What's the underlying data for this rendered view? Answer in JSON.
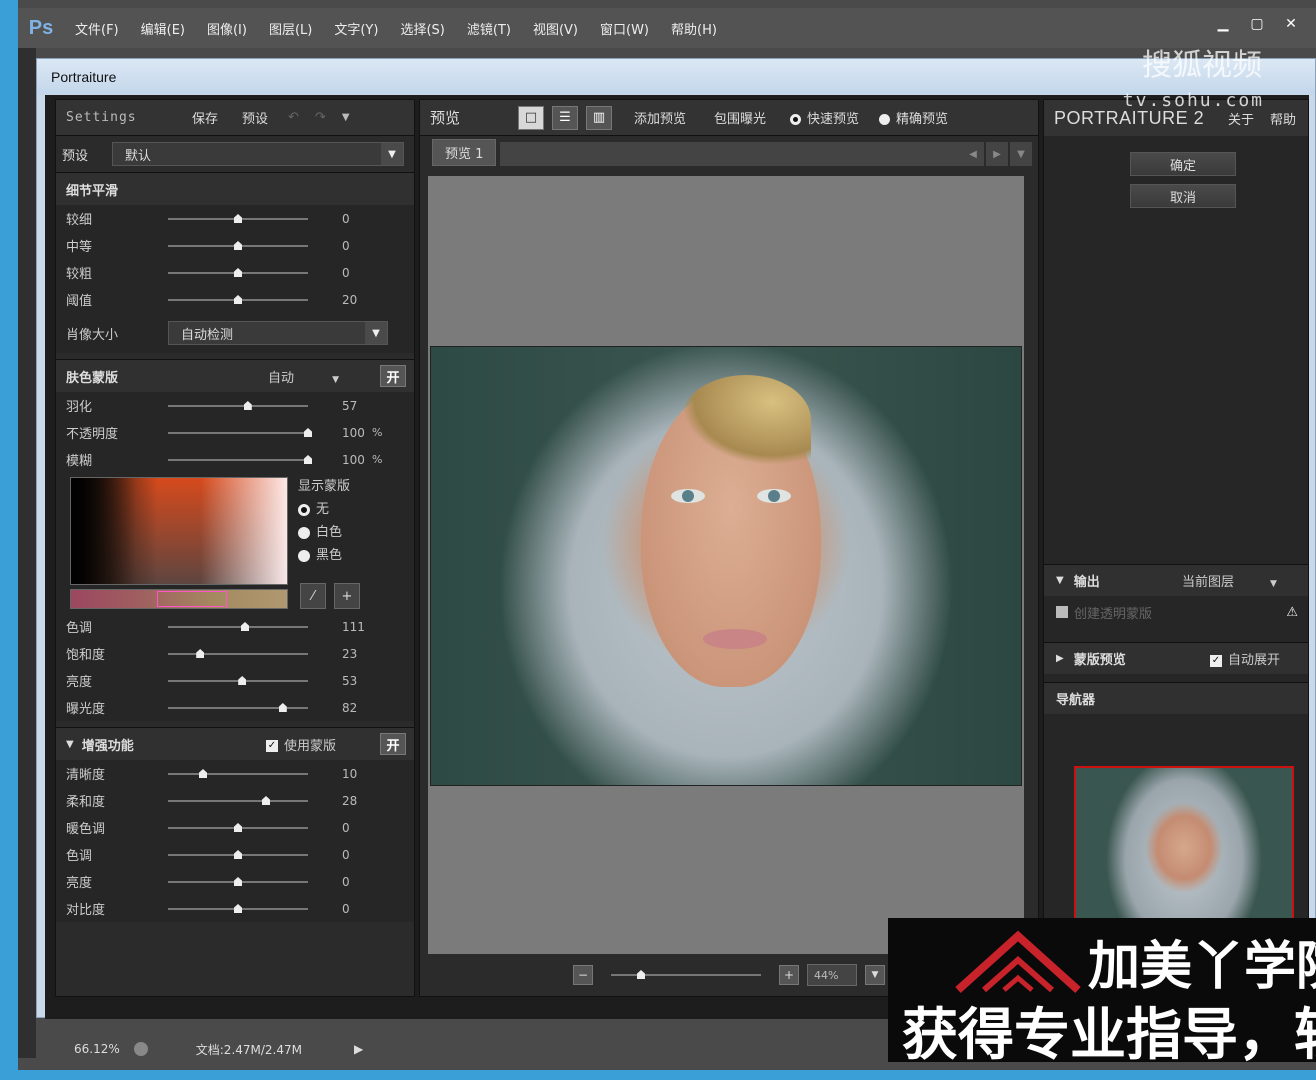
{
  "ps": {
    "logo": "Ps",
    "menu": [
      "文件(F)",
      "编辑(E)",
      "图像(I)",
      "图层(L)",
      "文字(Y)",
      "选择(S)",
      "滤镜(T)",
      "视图(V)",
      "窗口(W)",
      "帮助(H)"
    ]
  },
  "dialog": {
    "title": "Portraiture"
  },
  "settings": {
    "header_label": "Settings",
    "save": "保存",
    "preset": "预设",
    "preset_label": "预设",
    "preset_value": "默认"
  },
  "detail": {
    "title": "细节平滑",
    "sliders": [
      {
        "name": "较细",
        "value": "0",
        "pos": 0.5
      },
      {
        "name": "中等",
        "value": "0",
        "pos": 0.5
      },
      {
        "name": "较粗",
        "value": "0",
        "pos": 0.5
      },
      {
        "name": "阈值",
        "value": "20",
        "pos": 0.5
      }
    ],
    "size_label": "肖像大小",
    "size_value": "自动检测"
  },
  "skin": {
    "title": "肤色蒙版",
    "mode": "自动",
    "toggle": "开",
    "sliders": [
      {
        "name": "羽化",
        "value": "57",
        "unit": "",
        "pos": 0.57
      },
      {
        "name": "不透明度",
        "value": "100",
        "unit": "%",
        "pos": 1.0
      },
      {
        "name": "模糊",
        "value": "100",
        "unit": "%",
        "pos": 1.0
      }
    ],
    "show_mask": "显示蒙版",
    "mask_options": [
      "无",
      "白色",
      "黑色"
    ],
    "color_sliders": [
      {
        "name": "色调",
        "value": "111",
        "pos": 0.55
      },
      {
        "name": "饱和度",
        "value": "23",
        "pos": 0.23
      },
      {
        "name": "亮度",
        "value": "53",
        "pos": 0.53
      },
      {
        "name": "曝光度",
        "value": "82",
        "pos": 0.82
      }
    ]
  },
  "enhance": {
    "title": "增强功能",
    "use_mask": "使用蒙版",
    "toggle": "开",
    "sliders": [
      {
        "name": "清晰度",
        "value": "10",
        "pos": 0.25
      },
      {
        "name": "柔和度",
        "value": "28",
        "pos": 0.7
      },
      {
        "name": "暖色调",
        "value": "0",
        "pos": 0.5
      },
      {
        "name": "色调",
        "value": "0",
        "pos": 0.5
      },
      {
        "name": "亮度",
        "value": "0",
        "pos": 0.5
      },
      {
        "name": "对比度",
        "value": "0",
        "pos": 0.5
      }
    ]
  },
  "preview": {
    "label": "预览",
    "add_preview": "添加预览",
    "bracket": "包围曝光",
    "fast": "快速预览",
    "accurate": "精确预览",
    "tab": "预览 1",
    "zoom": "44%"
  },
  "right": {
    "title": "PORTRAITURE 2",
    "about": "关于",
    "help": "帮助",
    "ok": "确定",
    "cancel": "取消",
    "output_label": "输出",
    "output_value": "当前图层",
    "transparent": "创建透明蒙版",
    "mask_preview": "蒙版预览",
    "auto_expand": "自动展开",
    "navigator": "导航器"
  },
  "status": {
    "zoom": "66.12%",
    "doc": "文档:2.47M/2.47M"
  },
  "watermark": {
    "brand": "搜狐视频",
    "url": "tv.sohu.com"
  },
  "overlay": {
    "line1": "加美丫学院",
    "line2": "获得专业指导，较"
  }
}
